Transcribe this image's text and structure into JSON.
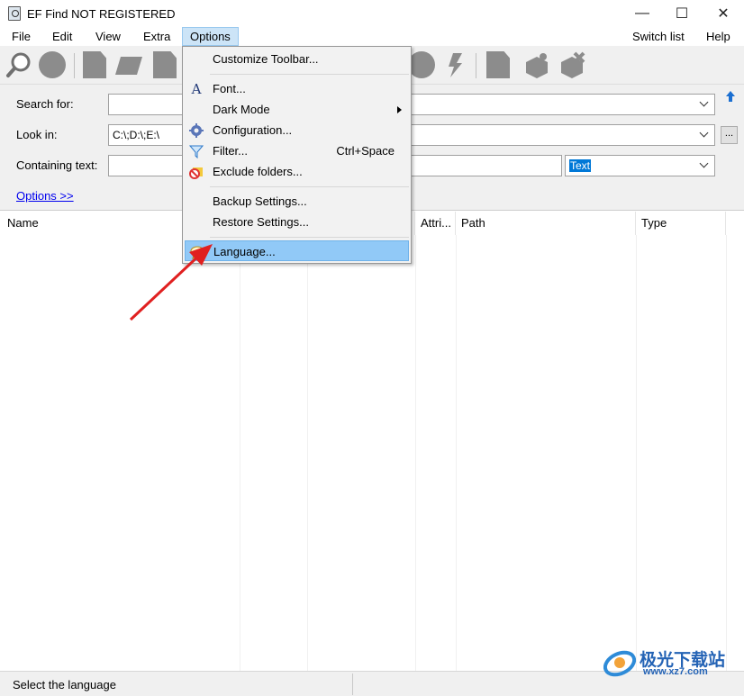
{
  "window": {
    "title": "EF Find NOT REGISTERED",
    "controls": [
      "—",
      "☐",
      "✕"
    ]
  },
  "menubar": {
    "left": [
      "File",
      "Edit",
      "View",
      "Extra",
      "Options"
    ],
    "right": [
      "Switch list",
      "Help"
    ]
  },
  "search": {
    "search_for_label": "Search for:",
    "search_for_value": "",
    "look_in_label": "Look in:",
    "look_in_value": "C:\\;D:\\;E:\\",
    "containing_text_label": "Containing text:",
    "containing_text_value": "",
    "text_mode": "Text",
    "browse_label": "...",
    "options_link": "Options  >>"
  },
  "columns": [
    "Name",
    "Attri...",
    "Path",
    "Type"
  ],
  "options_menu": {
    "items": [
      {
        "label": "Customize Toolbar...",
        "icon": ""
      },
      {
        "label": "Font...",
        "icon": "font-icon"
      },
      {
        "label": "Dark Mode",
        "icon": "",
        "submenu": true
      },
      {
        "label": "Configuration...",
        "icon": "gear-icon"
      },
      {
        "label": "Filter...",
        "icon": "funnel-icon",
        "shortcut": "Ctrl+Space"
      },
      {
        "label": "Exclude folders...",
        "icon": "exclude-folder-icon"
      },
      {
        "label": "Backup Settings...",
        "icon": ""
      },
      {
        "label": "Restore Settings...",
        "icon": ""
      },
      {
        "label": "Language...",
        "icon": "speech-bubble-icon",
        "highlighted": true
      }
    ]
  },
  "statusbar": {
    "text": "Select the language"
  },
  "watermark": {
    "cn": "极光下载站",
    "url": "www.xz7.com"
  },
  "colors": {
    "menu_highlight": "#91c9f7",
    "selection": "#0078d7",
    "link": "#0000ee",
    "arrow": "#e02020",
    "watermark": "#2463b5"
  }
}
